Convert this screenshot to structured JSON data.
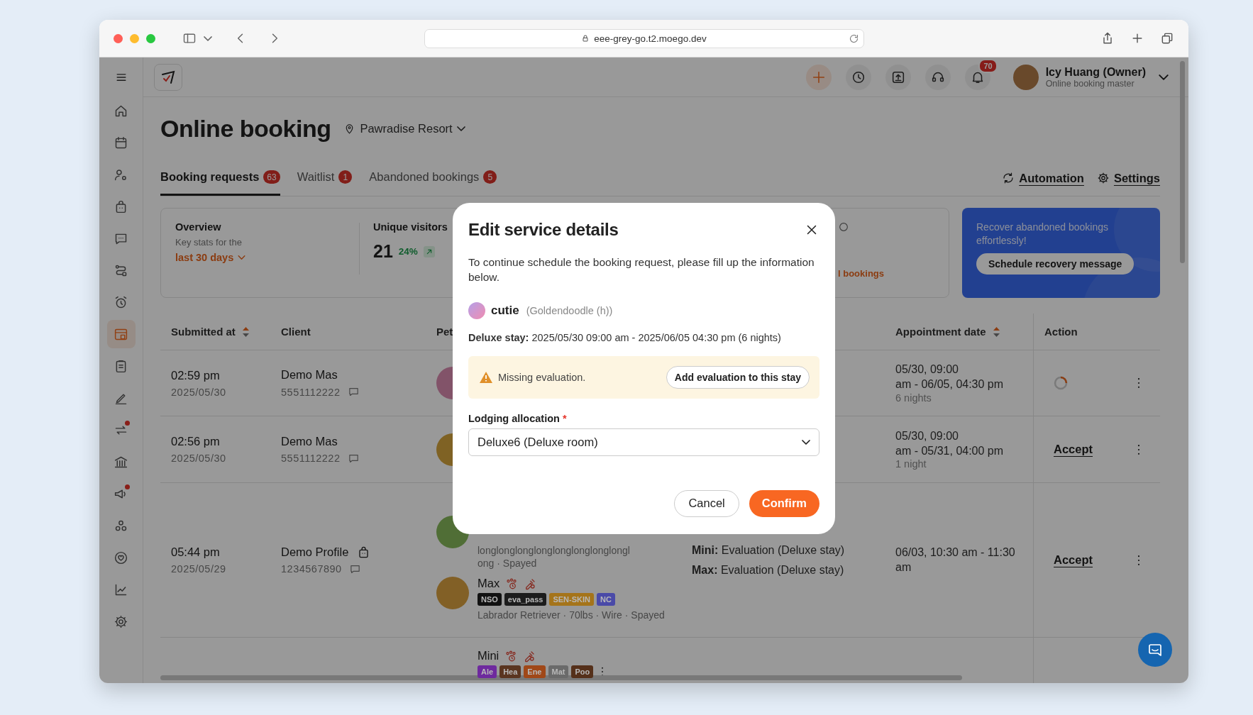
{
  "browser": {
    "url": "eee-grey-go.t2.moego.dev"
  },
  "sidebar": {
    "items": [
      {
        "selected": false,
        "alert": false
      },
      {
        "selected": false,
        "alert": false
      },
      {
        "selected": false,
        "alert": false
      },
      {
        "selected": false,
        "alert": false
      },
      {
        "selected": false,
        "alert": false
      },
      {
        "selected": false,
        "alert": false
      },
      {
        "selected": false,
        "alert": false
      },
      {
        "selected": true,
        "alert": false
      },
      {
        "selected": false,
        "alert": false
      },
      {
        "selected": false,
        "alert": false
      },
      {
        "selected": false,
        "alert": true
      },
      {
        "selected": false,
        "alert": false
      },
      {
        "selected": false,
        "alert": true
      },
      {
        "selected": false,
        "alert": false
      },
      {
        "selected": false,
        "alert": false
      },
      {
        "selected": false,
        "alert": false
      },
      {
        "selected": false,
        "alert": false
      }
    ]
  },
  "header": {
    "notifications": "70",
    "user_name": "Icy Huang (Owner)",
    "user_role": "Online booking master"
  },
  "page": {
    "title": "Online booking",
    "location": "Pawradise Resort"
  },
  "tabs": [
    {
      "label": "Booking requests",
      "count": "63",
      "selected": true
    },
    {
      "label": "Waitlist",
      "count": "1",
      "selected": false
    },
    {
      "label": "Abandoned bookings",
      "count": "5",
      "selected": false
    }
  ],
  "tab_actions": [
    {
      "kind": "automation",
      "label": "Automation"
    },
    {
      "kind": "settings",
      "label": "Settings"
    }
  ],
  "overview": {
    "title": "Overview",
    "subtitle": "Key stats for the",
    "period": "last 30 days",
    "stat_label": "Unique visitors",
    "stat_value": "21",
    "stat_change": "24%",
    "partial_link": "l bookings"
  },
  "promo": {
    "text": "Recover abandoned bookings effortlessly!",
    "button": "Schedule recovery message"
  },
  "table": {
    "columns": [
      {
        "label": "Submitted at",
        "sortable": true
      },
      {
        "label": "Client",
        "sortable": false
      },
      {
        "label": "Pet",
        "sortable": false
      },
      {
        "label": "Appointment date",
        "sortable": true
      },
      {
        "label": "Action",
        "sortable": false
      }
    ],
    "rows": [
      {
        "time": "02:59 pm",
        "date": "2025/05/30",
        "client": "Demo Mas",
        "phone": "5551112222",
        "client_badge": false,
        "pets": [
          {
            "kind": "avatar"
          }
        ],
        "services": [],
        "appointment": [
          "05/30, 09:00",
          "am - 06/05, 04:30 pm"
        ],
        "duration": "6 nights",
        "action": {
          "kind": "loading"
        }
      },
      {
        "time": "02:56 pm",
        "date": "2025/05/30",
        "client": "Demo Mas",
        "phone": "5551112222",
        "client_badge": false,
        "pets": [
          {
            "kind": "avatar"
          }
        ],
        "services": [],
        "appointment": [
          "05/30, 09:00",
          "am - 05/31, 04:00 pm"
        ],
        "duration": "1 night",
        "action": {
          "kind": "accept",
          "label": "Accept"
        }
      },
      {
        "time": "05:44 pm",
        "date": "2025/05/29",
        "client": "Demo Profile",
        "phone": "1234567890",
        "client_badge": true,
        "pets": [
          {
            "kind": "partial",
            "details": [
              "longlonglonglonglonglonglonglongl",
              "ong · Spayed"
            ]
          },
          {
            "kind": "full",
            "name": "Max",
            "warnings": true,
            "tags": [
              {
                "label": "NSO",
                "color": "#111111"
              },
              {
                "label": "eva_pass",
                "color": "#1c1c1c"
              },
              {
                "label": "SEN-SKIN",
                "color": "#a5741a"
              },
              {
                "label": "NC",
                "color": "#4a4aa8"
              }
            ],
            "details": [
              "Labrador Retriever · 70lbs · Wire · Spayed"
            ]
          }
        ],
        "services": [
          "**Mini:** Evaluation (Deluxe stay)",
          "**Max:** Evaluation (Deluxe stay)"
        ],
        "appointment": [
          "06/03, 10:30 am - 11:30",
          "am"
        ],
        "action": {
          "kind": "accept",
          "label": "Accept"
        }
      },
      {
        "pets": [
          {
            "kind": "full",
            "name": "Mini",
            "warnings": true,
            "more": true,
            "tags": [
              {
                "label": "Ale",
                "color": "#6e2a9e"
              },
              {
                "label": "Hea",
                "color": "#5a3520"
              },
              {
                "label": "Ene",
                "color": "#a04818"
              },
              {
                "label": "Mat",
                "color": "#6a6a6a"
              },
              {
                "label": "Poo",
                "color": "#55301a"
              }
            ]
          }
        ]
      }
    ]
  },
  "modal": {
    "title": "Edit service details",
    "message": "To continue schedule the booking request, please fill up the information below.",
    "pet_name": "cutie",
    "pet_breed": "(Goldendoodle (h))",
    "stay": "**Deluxe stay:** 2025/05/30 09:00 am - 2025/06/05 04:30 pm (6 nights)",
    "warning": "Missing evaluation.",
    "warning_button": "Add evaluation to this stay",
    "field_label": "Lodging allocation",
    "required_mark": "*",
    "field_value": "Deluxe6 (Deluxe room)",
    "cancel": "Cancel",
    "confirm": "Confirm"
  }
}
